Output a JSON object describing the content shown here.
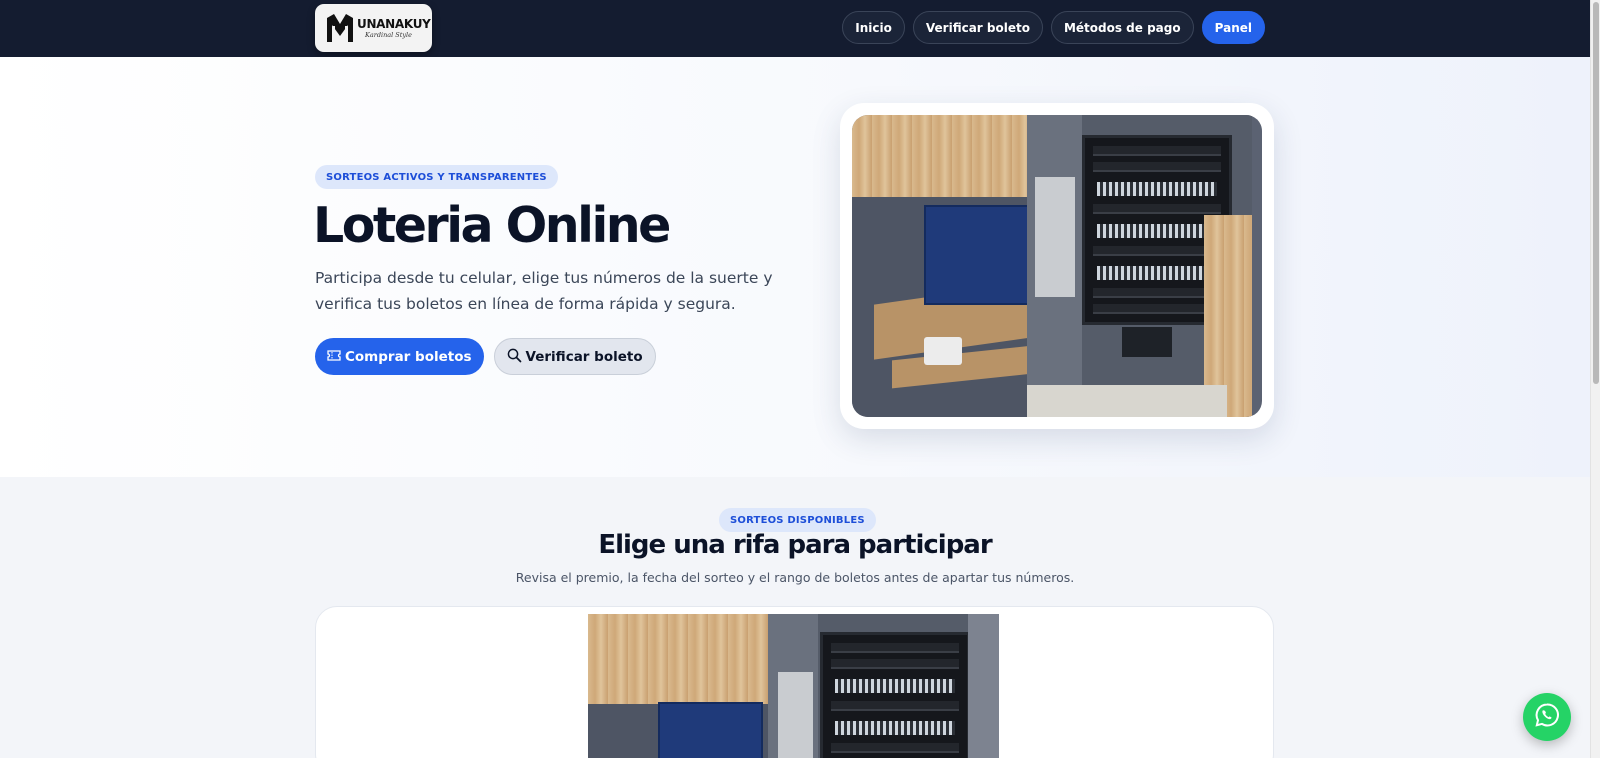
{
  "header": {
    "logo": {
      "word": "UNANAKUY",
      "tagline": "Kardinal Style"
    },
    "nav": [
      {
        "label": "Inicio"
      },
      {
        "label": "Verificar boleto"
      },
      {
        "label": "Métodos de pago"
      },
      {
        "label": "Panel"
      }
    ]
  },
  "hero": {
    "badge": "SORTEOS ACTIVOS Y TRANSPARENTES",
    "title": "Loteria Online",
    "description": "Participa desde tu celular, elige tus números de la suerte y verifica tus boletos en línea de forma rápida y segura.",
    "buy_label": "Comprar boletos",
    "buy_icon": "ticket-icon",
    "verify_label": "Verificar boleto",
    "verify_icon": "search-icon",
    "image": "server-cabinet-photo"
  },
  "raffles": {
    "badge": "SORTEOS DISPONIBLES",
    "title": "Elige una rifa para participar",
    "subtitle": "Revisa el premio, la fecha del sorteo y el rango de boletos antes de apartar tus números.",
    "card_image": "server-cabinet-photo"
  },
  "floating": {
    "whatsapp_icon": "whatsapp-icon"
  },
  "colors": {
    "navbar": "#141c30",
    "accent": "#2563eb",
    "badge_bg": "#dde7fb",
    "whatsapp": "#25d366"
  }
}
